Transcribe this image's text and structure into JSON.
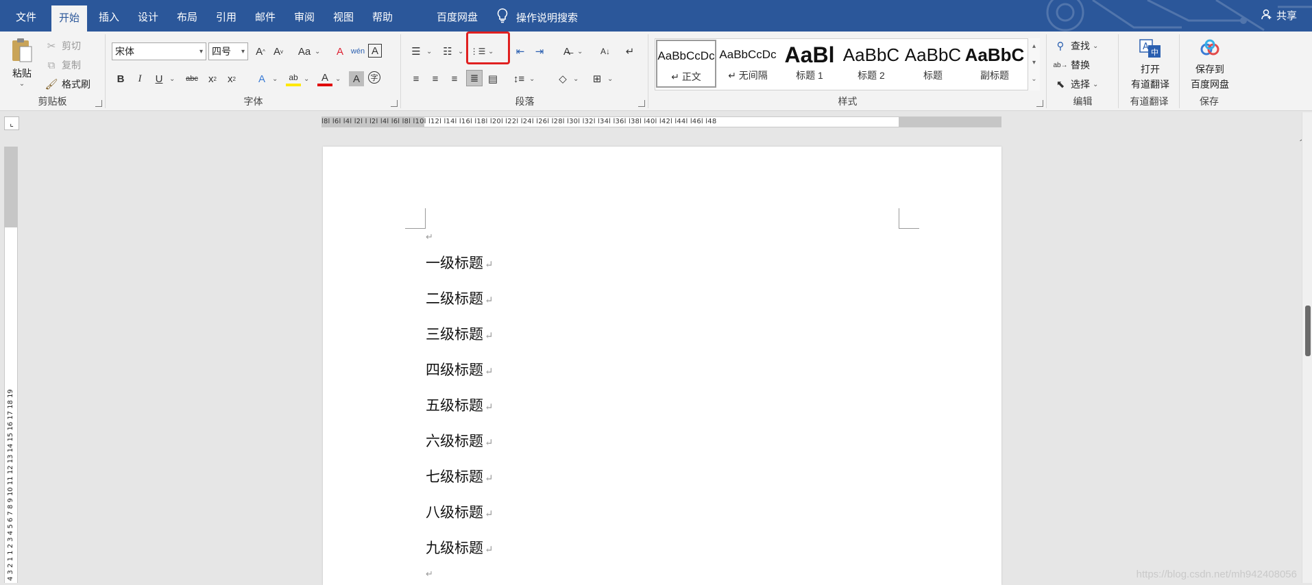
{
  "tabs": [
    "文件",
    "开始",
    "插入",
    "设计",
    "布局",
    "引用",
    "邮件",
    "审阅",
    "视图",
    "帮助",
    "百度网盘"
  ],
  "active_tab_index": 1,
  "tell_me": "操作说明搜索",
  "share": "共享",
  "clipboard": {
    "paste": "粘贴",
    "cut": "剪切",
    "copy": "复制",
    "format_painter": "格式刷",
    "group_label": "剪贴板"
  },
  "font": {
    "font_name": "宋体",
    "font_size": "四号",
    "group_label": "字体"
  },
  "paragraph": {
    "group_label": "段落"
  },
  "styles": {
    "group_label": "样式",
    "items": [
      {
        "preview": "AaBbCcDc",
        "name": "↵ 正文",
        "selected": true
      },
      {
        "preview": "AaBbCcDc",
        "name": "↵ 无间隔"
      },
      {
        "preview": "AaBl",
        "name": "标题 1"
      },
      {
        "preview": "AaBbC",
        "name": "标题 2"
      },
      {
        "preview": "AaBbC",
        "name": "标题"
      },
      {
        "preview": "AaBbC",
        "name": "副标题"
      }
    ]
  },
  "editing": {
    "find": "查找",
    "replace": "替换",
    "select": "选择",
    "group_label": "编辑"
  },
  "youdao": {
    "line1": "打开",
    "line2": "有道翻译",
    "group_label": "有道翻译"
  },
  "save_baidu": {
    "line1": "保存到",
    "line2": "百度网盘",
    "group_label": "保存"
  },
  "ruler": {
    "horizontal": "l8l l6l l4l l2l l l2l l4l l6l l8l l10l l12l l14l l16l l18l l20l l22l l24l l26l l28l l30l l32l l34l l36l l38l l40l l42l l44l l46l l48",
    "vertical": "4 3 2 1 1 2 3 4 5 6 7 8 9 10 11 12 13 14 15 16 17 18 19"
  },
  "document": {
    "paragraphs": [
      "一级标题",
      "二级标题",
      "三级标题",
      "四级标题",
      "五级标题",
      "六级标题",
      "七级标题",
      "八级标题",
      "九级标题"
    ],
    "para_mark": "↵"
  },
  "watermark": "https://blog.csdn.net/mh942408056",
  "colors": {
    "title_bar": "#2b579a",
    "ribbon": "#f3f3f3",
    "highlight": "#e02020"
  }
}
